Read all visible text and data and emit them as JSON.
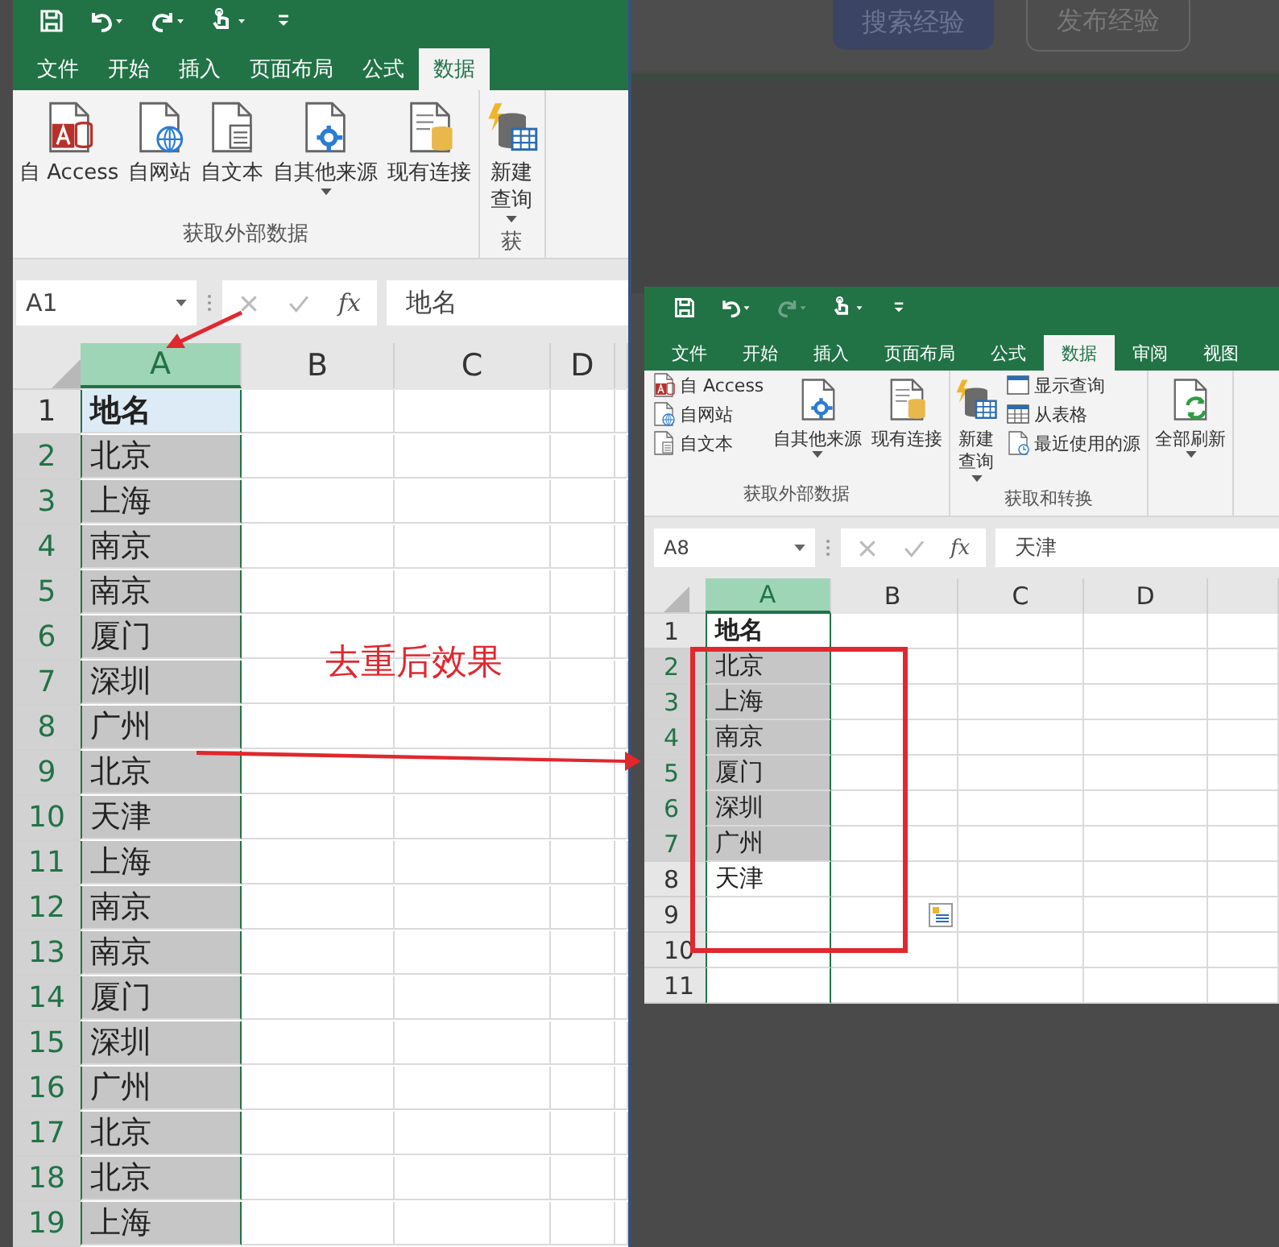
{
  "page_buttons": [
    {
      "label": "搜索经验",
      "kind": "primary"
    },
    {
      "label": "发布经验",
      "kind": "outline"
    }
  ],
  "windows": [
    {
      "quick_access": [
        {
          "kind": "save",
          "disabled": false
        },
        {
          "kind": "undo",
          "disabled": false
        },
        {
          "kind": "redo",
          "disabled": false
        },
        {
          "kind": "touch",
          "disabled": false
        },
        {
          "kind": "customize",
          "disabled": false
        }
      ],
      "tabs": [
        {
          "label": "文件",
          "selected": false
        },
        {
          "label": "开始",
          "selected": false
        },
        {
          "label": "插入",
          "selected": false
        },
        {
          "label": "页面布局",
          "selected": false
        },
        {
          "label": "公式",
          "selected": false
        },
        {
          "label": "数据",
          "selected": true
        }
      ],
      "ribbon_groups": [
        {
          "label": "获取外部数据",
          "columns": [
            {
              "kind": "large",
              "items": [
                {
                  "kind": "access",
                  "label": "自 Access",
                  "dropdown": false
                }
              ]
            },
            {
              "kind": "large",
              "items": [
                {
                  "kind": "web",
                  "label": "自网站",
                  "dropdown": false
                }
              ]
            },
            {
              "kind": "large",
              "items": [
                {
                  "kind": "text",
                  "label": "自文本",
                  "dropdown": false
                }
              ]
            },
            {
              "kind": "large",
              "items": [
                {
                  "kind": "other",
                  "label": "自其他来源",
                  "dropdown": true
                }
              ]
            },
            {
              "kind": "large",
              "items": [
                {
                  "kind": "existing",
                  "label": "现有连接",
                  "dropdown": false
                }
              ]
            }
          ]
        },
        {
          "label": "获",
          "columns": [
            {
              "kind": "large",
              "items": [
                {
                  "kind": "query",
                  "label": "新建查询",
                  "dropdown": true
                }
              ]
            }
          ]
        }
      ],
      "name_box": "A1",
      "function_button": "fx",
      "formula": "地名",
      "columns": [
        {
          "label": "A",
          "selected": true
        },
        {
          "label": "B",
          "selected": false
        },
        {
          "label": "C",
          "selected": false
        },
        {
          "label": "D",
          "selected": false
        }
      ],
      "rows": [
        {
          "number": "1",
          "value": "地名",
          "selected": false,
          "highlighted": true
        },
        {
          "number": "2",
          "value": "北京",
          "selected": true
        },
        {
          "number": "3",
          "value": "上海",
          "selected": true
        },
        {
          "number": "4",
          "value": "南京",
          "selected": true
        },
        {
          "number": "5",
          "value": "南京",
          "selected": true
        },
        {
          "number": "6",
          "value": "厦门",
          "selected": true
        },
        {
          "number": "7",
          "value": "深圳",
          "selected": true
        },
        {
          "number": "8",
          "value": "广州",
          "selected": true
        },
        {
          "number": "9",
          "value": "北京",
          "selected": true
        },
        {
          "number": "10",
          "value": "天津",
          "selected": true
        },
        {
          "number": "11",
          "value": "上海",
          "selected": true
        },
        {
          "number": "12",
          "value": "南京",
          "selected": true
        },
        {
          "number": "13",
          "value": "南京",
          "selected": true
        },
        {
          "number": "14",
          "value": "厦门",
          "selected": true
        },
        {
          "number": "15",
          "value": "深圳",
          "selected": true
        },
        {
          "number": "16",
          "value": "广州",
          "selected": true
        },
        {
          "number": "17",
          "value": "北京",
          "selected": true
        },
        {
          "number": "18",
          "value": "北京",
          "selected": true
        },
        {
          "number": "19",
          "value": "上海",
          "selected": true
        }
      ]
    },
    {
      "quick_access": [
        {
          "kind": "save",
          "disabled": false
        },
        {
          "kind": "undo",
          "disabled": false
        },
        {
          "kind": "redo",
          "disabled": true
        },
        {
          "kind": "touch",
          "disabled": false
        },
        {
          "kind": "customize",
          "disabled": false
        }
      ],
      "tabs": [
        {
          "label": "文件",
          "selected": false
        },
        {
          "label": "开始",
          "selected": false
        },
        {
          "label": "插入",
          "selected": false
        },
        {
          "label": "页面布局",
          "selected": false
        },
        {
          "label": "公式",
          "selected": false
        },
        {
          "label": "数据",
          "selected": true
        },
        {
          "label": "审阅",
          "selected": false
        },
        {
          "label": "视图",
          "selected": false
        }
      ],
      "ribbon_groups": [
        {
          "label": "获取外部数据",
          "columns": [
            {
              "kind": "stack",
              "items": [
                {
                  "kind": "access",
                  "label": "自 Access",
                  "dropdown": false
                },
                {
                  "kind": "web",
                  "label": "自网站",
                  "dropdown": false
                },
                {
                  "kind": "text",
                  "label": "自文本",
                  "dropdown": false
                }
              ]
            },
            {
              "kind": "large",
              "items": [
                {
                  "kind": "other",
                  "label": "自其他来源",
                  "dropdown": true
                }
              ]
            },
            {
              "kind": "large",
              "items": [
                {
                  "kind": "existing",
                  "label": "现有连接",
                  "dropdown": false
                }
              ]
            }
          ]
        },
        {
          "label": "获取和转换",
          "columns": [
            {
              "kind": "large",
              "items": [
                {
                  "kind": "query",
                  "label": "新建查询",
                  "dropdown": true
                }
              ]
            },
            {
              "kind": "stack",
              "items": [
                {
                  "kind": "show",
                  "label": "显示查询",
                  "dropdown": false
                },
                {
                  "kind": "table",
                  "label": "从表格",
                  "dropdown": false
                },
                {
                  "kind": "recent",
                  "label": "最近使用的源",
                  "dropdown": false
                }
              ]
            }
          ]
        },
        {
          "columns": [
            {
              "kind": "large",
              "items": [
                {
                  "kind": "refresh",
                  "label": "全部刷新",
                  "dropdown": true
                }
              ]
            }
          ]
        }
      ],
      "name_box": "A8",
      "function_button": "fx",
      "formula": "天津",
      "columns": [
        {
          "label": "A",
          "selected": true
        },
        {
          "label": "B",
          "selected": false
        },
        {
          "label": "C",
          "selected": false
        },
        {
          "label": "D",
          "selected": false
        }
      ],
      "rows": [
        {
          "number": "1",
          "value": "地名",
          "selected": false
        },
        {
          "number": "2",
          "value": "北京",
          "selected": true
        },
        {
          "number": "3",
          "value": "上海",
          "selected": true
        },
        {
          "number": "4",
          "value": "南京",
          "selected": true
        },
        {
          "number": "5",
          "value": "厦门",
          "selected": true
        },
        {
          "number": "6",
          "value": "深圳",
          "selected": true
        },
        {
          "number": "7",
          "value": "广州",
          "selected": true
        },
        {
          "number": "8",
          "value": "天津",
          "selected": false
        },
        {
          "number": "9",
          "selected": false,
          "paste_options": true
        },
        {
          "number": "10",
          "selected": false
        },
        {
          "number": "11",
          "selected": false
        }
      ]
    }
  ],
  "annotation": "去重后效果"
}
